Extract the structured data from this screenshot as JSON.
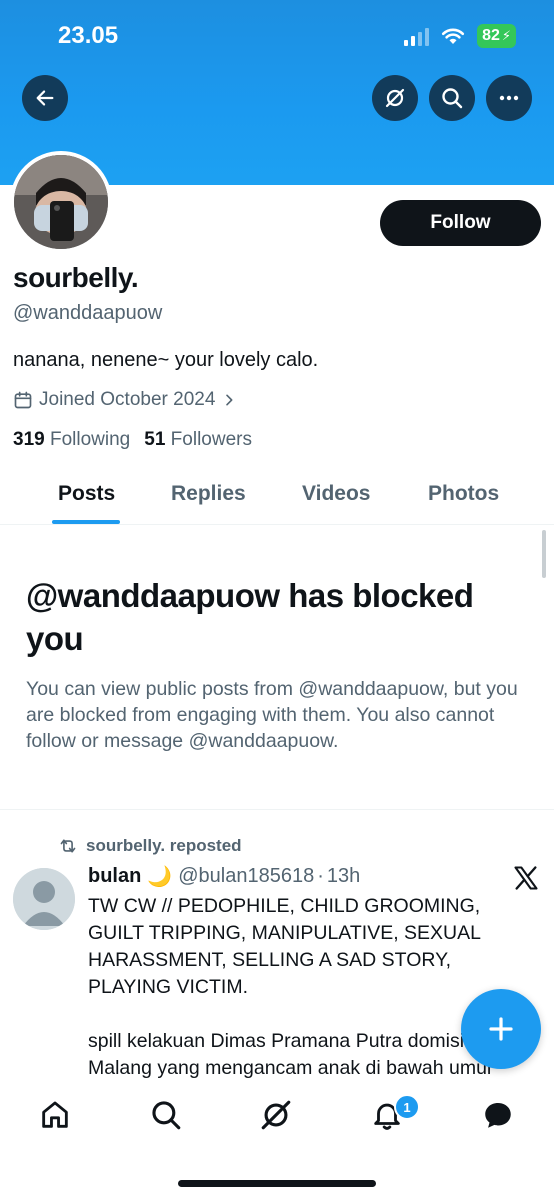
{
  "status": {
    "time": "23.05",
    "battery": "82"
  },
  "colors": {
    "accent": "#1d9bf0",
    "banner": "#1b9af0",
    "text": "#0f1419",
    "muted": "#536471"
  },
  "profile": {
    "name": "sourbelly.",
    "handle": "@wanddaapuow",
    "bio": "nanana, nenene~ your lovely calo.",
    "joined": "Joined October 2024",
    "following_count": "319",
    "following_label": "Following",
    "followers_count": "51",
    "followers_label": "Followers",
    "follow_label": "Follow"
  },
  "tabs": [
    {
      "label": "Posts",
      "active": true
    },
    {
      "label": "Replies",
      "active": false
    },
    {
      "label": "Videos",
      "active": false
    },
    {
      "label": "Photos",
      "active": false
    }
  ],
  "blocked": {
    "title": "@wanddaapuow has blocked you",
    "text": "You can view public posts from @wanddaapuow, but you are blocked from engaging with them. You also cannot follow or message @wanddaapuow."
  },
  "post": {
    "repost_label": "sourbelly. reposted",
    "author": "bulan",
    "author_emoji": "🌙",
    "handle": "@bulan185618",
    "separator": "·",
    "time": "13h",
    "body": "TW CW // PEDOPHILE, CHILD GROOMING, GUILT TRIPPING, MANIPULATIVE, SEXUAL HARASSMENT, SELLING A SAD STORY, PLAYING VICTIM.\n\nspill kelakuan Dimas Pramana Putra domisili Malang yang mengancam anak di bawah umur"
  },
  "nav": {
    "notifications_badge": "1"
  },
  "icons": [
    "back-icon",
    "grok-icon",
    "search-icon",
    "more-icon",
    "calendar-icon",
    "chevron-right-icon",
    "repost-icon",
    "x-logo-icon",
    "plus-icon",
    "home-icon",
    "bell-icon",
    "messages-icon"
  ]
}
